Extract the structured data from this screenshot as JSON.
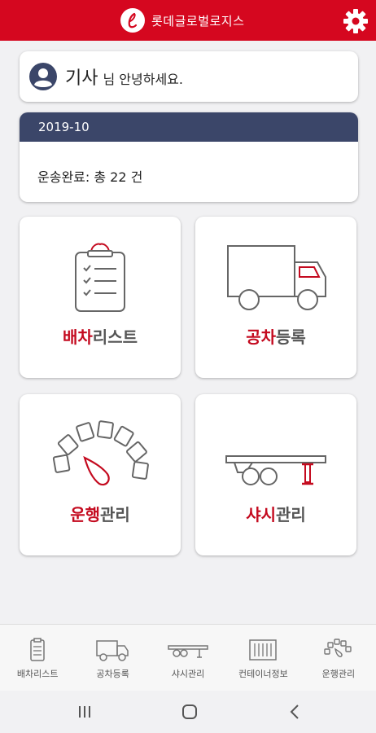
{
  "header": {
    "brand_name": "롯데글로벌로지스",
    "logo_letter": "ℓ",
    "settings_icon": "gear-icon",
    "color": "#d5071f"
  },
  "greeting": {
    "name": "기사",
    "suffix": "님 안녕하세요.",
    "icon": "user-icon"
  },
  "summary": {
    "period": "2019-10",
    "text": "운송완료: 총 22 건",
    "header_color": "#3b4669"
  },
  "tiles": [
    {
      "icon": "clipboard-checklist-icon",
      "highlight": "배차",
      "rest": "리스트"
    },
    {
      "icon": "truck-icon",
      "highlight": "공차",
      "rest": "등록"
    },
    {
      "icon": "gauge-icon",
      "highlight": "운행",
      "rest": "관리"
    },
    {
      "icon": "chassis-icon",
      "highlight": "샤시",
      "rest": "관리"
    }
  ],
  "accent_color": "#c40a1f",
  "bottom_nav": [
    {
      "icon": "clipboard-icon",
      "label": "배차리스트"
    },
    {
      "icon": "truck-icon",
      "label": "공차등록"
    },
    {
      "icon": "chassis-icon",
      "label": "샤시관리"
    },
    {
      "icon": "container-icon",
      "label": "컨테이너정보"
    },
    {
      "icon": "gauge-icon",
      "label": "운행관리"
    }
  ],
  "system_nav": {
    "recents_icon": "recents-icon",
    "home_icon": "home-icon",
    "back_icon": "back-icon"
  }
}
